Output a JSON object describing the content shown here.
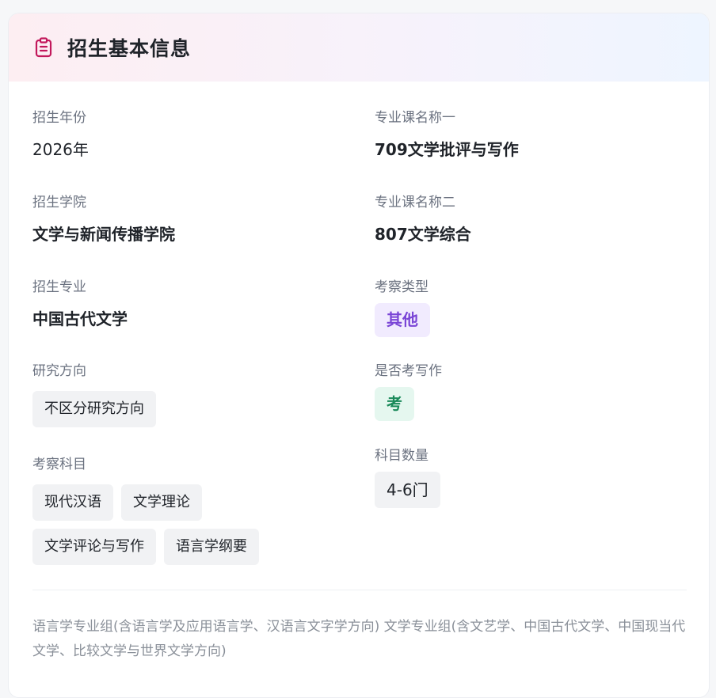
{
  "card": {
    "title": "招生基本信息",
    "icon": "clipboard-icon",
    "accent": "#c2185b"
  },
  "left": {
    "year": {
      "label": "招生年份",
      "value": "2026年"
    },
    "college": {
      "label": "招生学院",
      "value": "文学与新闻传播学院"
    },
    "major": {
      "label": "招生专业",
      "value": "中国古代文学"
    },
    "direction": {
      "label": "研究方向",
      "tags": [
        "不区分研究方向"
      ]
    },
    "subjects": {
      "label": "考察科目",
      "tags": [
        "现代汉语",
        "文学理论",
        "文学评论与写作",
        "语言学纲要"
      ]
    }
  },
  "right": {
    "course1": {
      "label": "专业课名称一",
      "value": "709文学批评与写作"
    },
    "course2": {
      "label": "专业课名称二",
      "value": "807文学综合"
    },
    "exam_type": {
      "label": "考察类型",
      "value": "其他",
      "color": "#7a45d6"
    },
    "writing": {
      "label": "是否考写作",
      "value": "考",
      "color": "#1a8a5a"
    },
    "subject_count": {
      "label": "科目数量",
      "value": "4-6门"
    }
  },
  "note": "语言学专业组(含语言学及应用语言学、汉语言文字学方向) 文学专业组(含文艺学、中国古代文学、中国现当代文学、比较文学与世界文学方向)"
}
